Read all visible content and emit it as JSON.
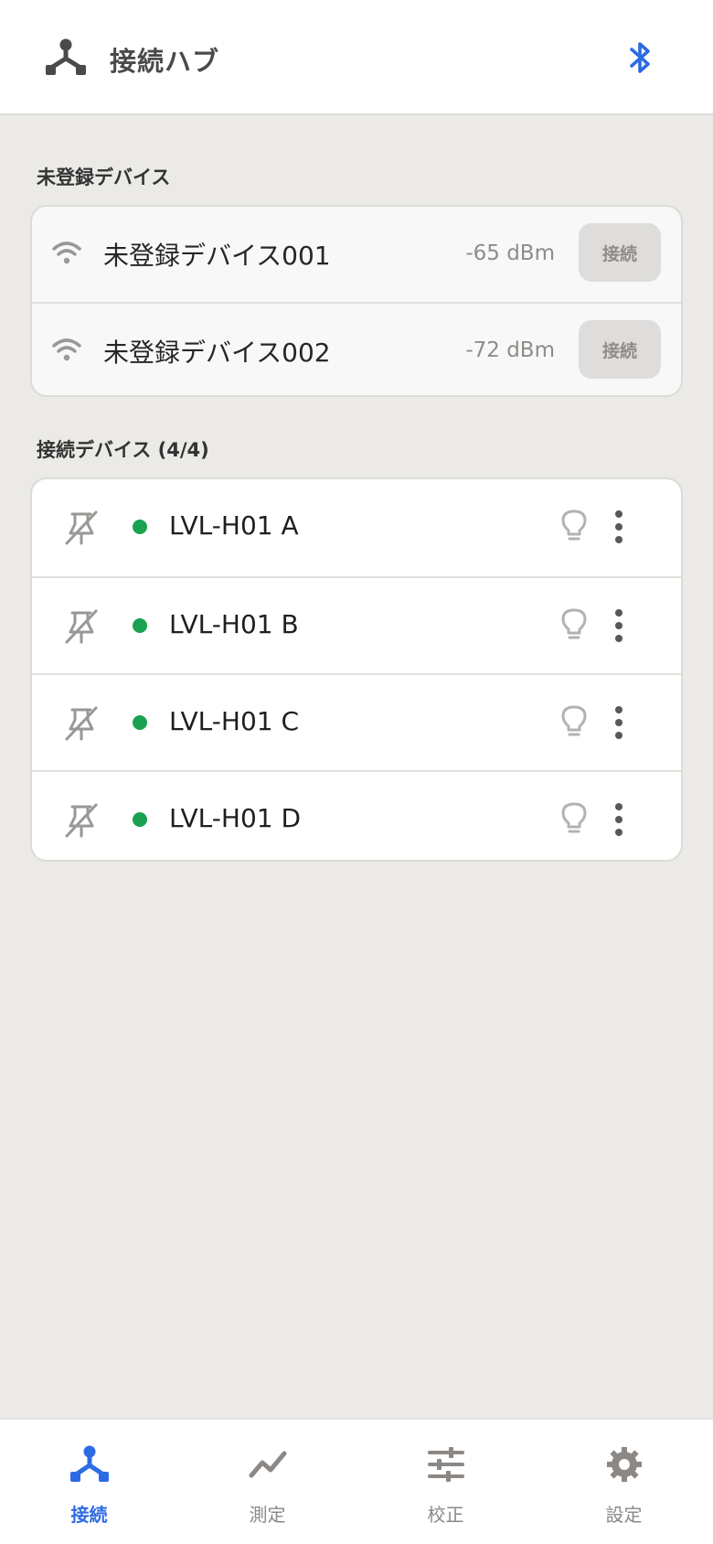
{
  "header": {
    "title": "接続ハブ",
    "hub_icon": "hub-icon",
    "bluetooth_icon": "bluetooth-icon"
  },
  "unregistered": {
    "label": "未登録デバイス",
    "devices": [
      {
        "name": "未登録デバイス001",
        "rssi": "-65 dBm",
        "button": "接続"
      },
      {
        "name": "未登録デバイス002",
        "rssi": "-72 dBm",
        "button": "接続"
      }
    ]
  },
  "connected": {
    "label": "接続デバイス (4/4)",
    "devices": [
      {
        "name": "LVL-H01 A"
      },
      {
        "name": "LVL-H01 B"
      },
      {
        "name": "LVL-H01 C"
      },
      {
        "name": "LVL-H01 D"
      }
    ]
  },
  "nav": {
    "items": [
      {
        "label": "接続",
        "icon": "hub-icon",
        "active": true
      },
      {
        "label": "測定",
        "icon": "trend-icon",
        "active": false
      },
      {
        "label": "校正",
        "icon": "sliders-icon",
        "active": false
      },
      {
        "label": "設定",
        "icon": "gear-icon",
        "active": false
      }
    ]
  },
  "colors": {
    "accent": "#2d6be4",
    "status_connected": "#1aa251",
    "background": "#ebeae7"
  }
}
